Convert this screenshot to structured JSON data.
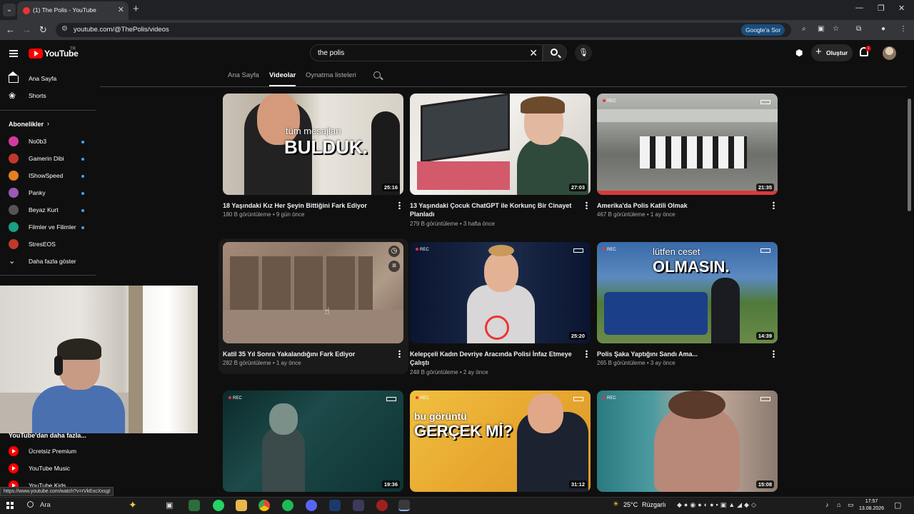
{
  "browser": {
    "tab_title": "(1) The Polis - YouTube",
    "url": "youtube.com/@ThePolis/videos",
    "google_ask": "Google'a Sor"
  },
  "youtube": {
    "logo_text": "YouTube",
    "logo_sup": "TR",
    "search_value": "the polis",
    "create_label": "Oluştur",
    "notif_count": "1"
  },
  "sidebar": {
    "home": "Ana Sayfa",
    "shorts": "Shorts",
    "subs_header": "Abonelikler",
    "channels": [
      {
        "name": "No0b3",
        "color": "#d33aa0"
      },
      {
        "name": "Gamerin Dibi",
        "color": "#c0392b"
      },
      {
        "name": "IShowSpeed",
        "color": "#e67e22"
      },
      {
        "name": "Panky",
        "color": "#9b59b6"
      },
      {
        "name": "Beyaz Kurt",
        "color": "#555555"
      },
      {
        "name": "Filmler ve Filimler",
        "color": "#16a085"
      },
      {
        "name": "StresEOS",
        "color": "#c0392b"
      }
    ],
    "show_more": "Daha fazla göster",
    "more_section": "YouTube'dan daha fazla...",
    "premium": "Ücretsiz Premium",
    "music": "YouTube Music",
    "kids": "YouTube Kids"
  },
  "channel_tabs": {
    "home": "Ana Sayfa",
    "videos": "Videolar",
    "playlists": "Oynatma listeleri"
  },
  "videos": [
    {
      "title": "18 Yaşındaki Kız Her Şeyin Bittiğini Fark Ediyor",
      "views": "180 B görüntüleme",
      "age": "9 gün önce",
      "duration": "25:16",
      "overlay_small": "tüm mesajları",
      "overlay_big": "BULDUK."
    },
    {
      "title": "13 Yaşındaki Çocuk ChatGPT ile Korkunç Bir Cinayet Planladı",
      "views": "279 B görüntüleme",
      "age": "3 hafta önce",
      "duration": "27:03"
    },
    {
      "title": "Amerika'da Polis Katili Olmak",
      "views": "467 B görüntüleme",
      "age": "1 ay önce",
      "duration": "21:35"
    },
    {
      "title": "Katil 35 Yıl Sonra Yakalandığını Fark Ediyor",
      "views": "282 B görüntüleme",
      "age": "1 ay önce",
      "duration": ""
    },
    {
      "title": "Kelepçeli Kadın Devriye Aracında Polisi İnfaz Etmeye Çalıştı",
      "views": "248 B görüntüleme",
      "age": "2 ay önce",
      "duration": "25:20"
    },
    {
      "title": "Polis Şaka Yaptığını Sandı Ama...",
      "views": "265 B görüntüleme",
      "age": "3 ay önce",
      "duration": "14:39",
      "overlay_small": "lütfen ceset",
      "overlay_big": "OLMASIN."
    },
    {
      "duration": "19:36"
    },
    {
      "duration": "31:12",
      "overlay_small": "bu görüntü",
      "overlay_big": "GERÇEK Mİ?"
    },
    {
      "duration": "15:08"
    }
  ],
  "rec_label": "REC",
  "status_url": "https://www.youtube.com/watch?v=rVkExcXxsgI",
  "taskbar": {
    "search": "Ara",
    "weather": "25°C",
    "weather_desc": "Rüzgarlı",
    "time": "17:57",
    "date": "13.08.2026"
  }
}
